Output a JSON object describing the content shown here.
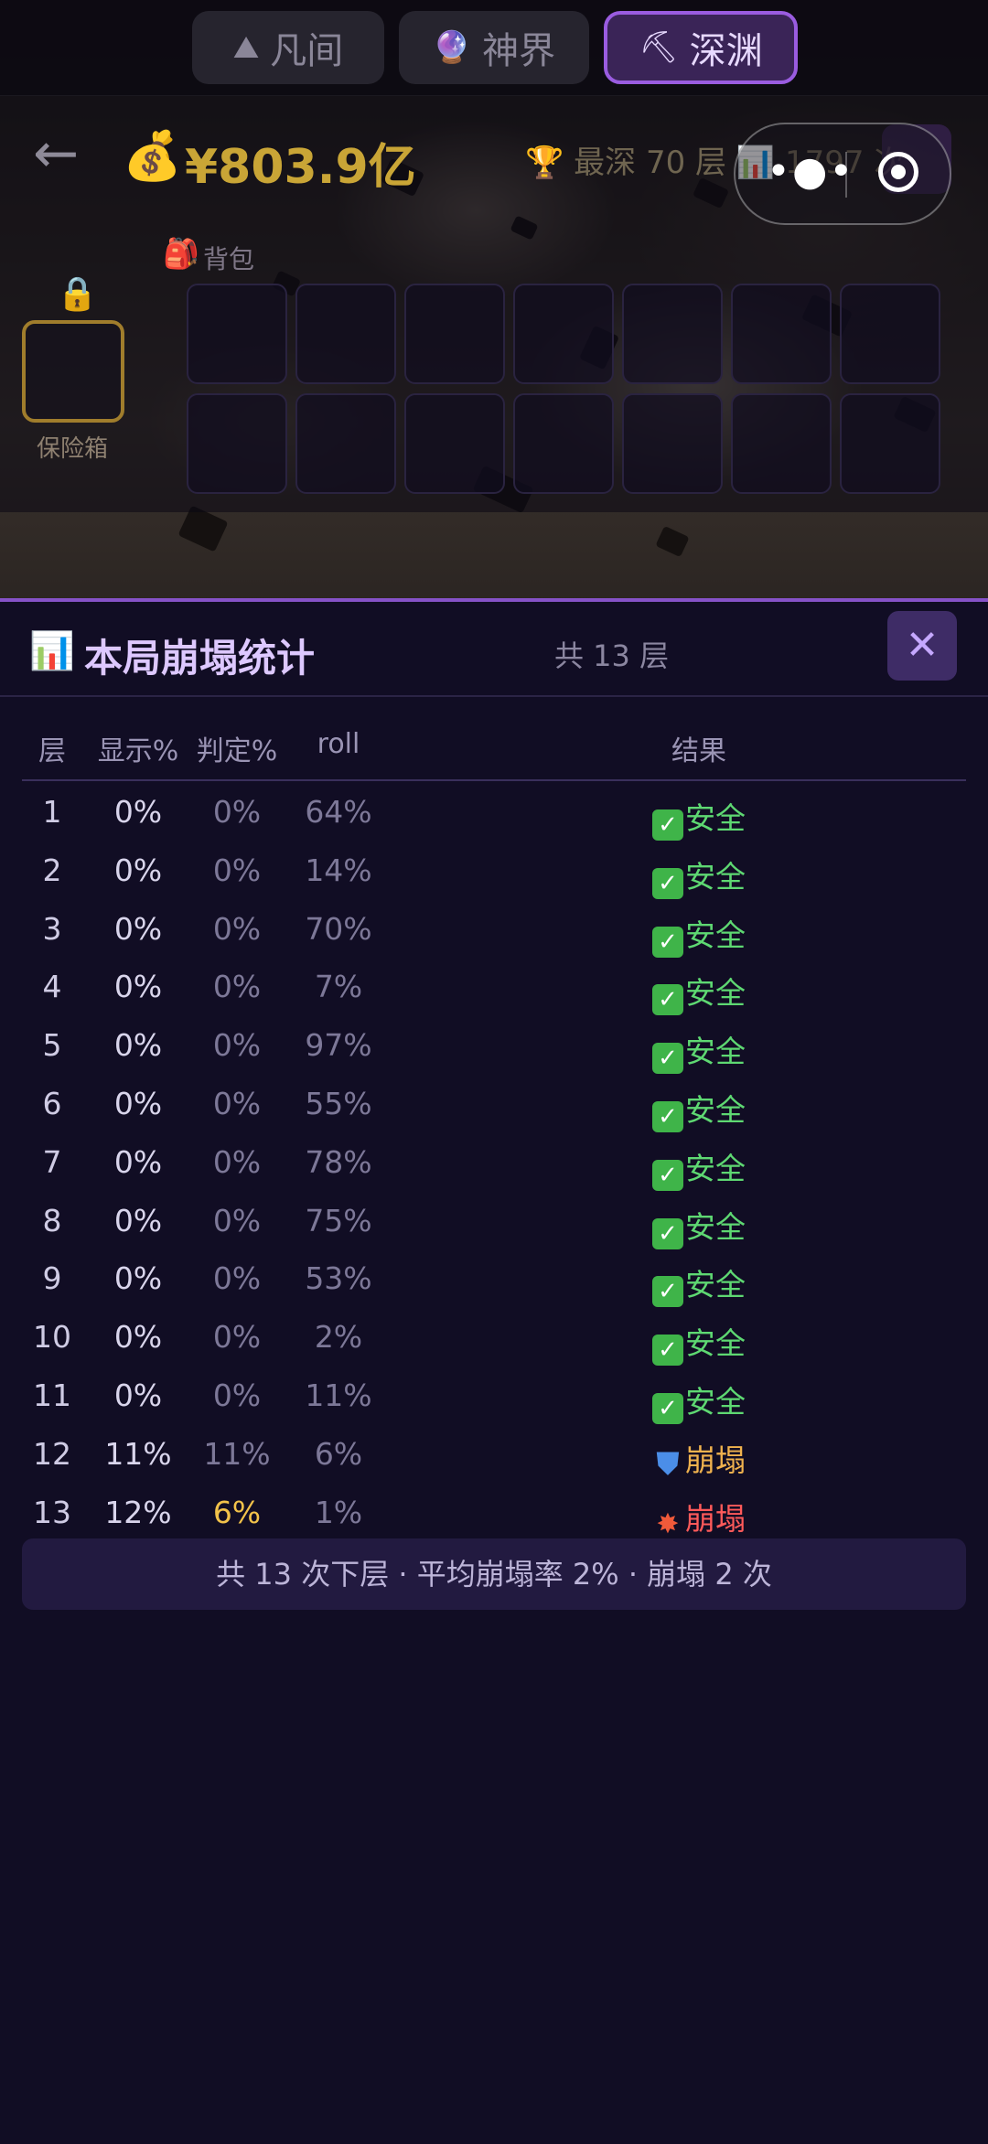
{
  "tabs": [
    {
      "icon": "mountain-icon",
      "glyph": "⛰",
      "label": "凡间",
      "active": false
    },
    {
      "icon": "crystal-ball-icon",
      "glyph": "🔮",
      "label": "神界",
      "active": false
    },
    {
      "icon": "pickaxe-icon",
      "glyph": "⛏",
      "label": "深渊",
      "active": true
    }
  ],
  "header": {
    "back_glyph": "←",
    "money_glyph": "💰",
    "money": "¥803.9亿",
    "trophy_glyph": "🏆",
    "deepest": "最深 70 层",
    "count_glyph": "📊",
    "count": "1797 次"
  },
  "inventory": {
    "lock_glyph": "🔒",
    "safe_label": "保险箱",
    "bag_glyph": "🎒",
    "bag_label": "背包",
    "slot_count": 14
  },
  "panel": {
    "icon_glyph": "📊",
    "title": "本局崩塌统计",
    "total": "共 13 层",
    "close_glyph": "✕",
    "columns": {
      "layer": "层",
      "display": "显示%",
      "judge": "判定%",
      "roll": "roll",
      "result": "结果"
    },
    "rows": [
      {
        "layer": "1",
        "display": "0%",
        "judge": "0%",
        "roll": "64%",
        "result": "安全",
        "status": "safe"
      },
      {
        "layer": "2",
        "display": "0%",
        "judge": "0%",
        "roll": "14%",
        "result": "安全",
        "status": "safe"
      },
      {
        "layer": "3",
        "display": "0%",
        "judge": "0%",
        "roll": "70%",
        "result": "安全",
        "status": "safe"
      },
      {
        "layer": "4",
        "display": "0%",
        "judge": "0%",
        "roll": "7%",
        "result": "安全",
        "status": "safe"
      },
      {
        "layer": "5",
        "display": "0%",
        "judge": "0%",
        "roll": "97%",
        "result": "安全",
        "status": "safe"
      },
      {
        "layer": "6",
        "display": "0%",
        "judge": "0%",
        "roll": "55%",
        "result": "安全",
        "status": "safe"
      },
      {
        "layer": "7",
        "display": "0%",
        "judge": "0%",
        "roll": "78%",
        "result": "安全",
        "status": "safe"
      },
      {
        "layer": "8",
        "display": "0%",
        "judge": "0%",
        "roll": "75%",
        "result": "安全",
        "status": "safe"
      },
      {
        "layer": "9",
        "display": "0%",
        "judge": "0%",
        "roll": "53%",
        "result": "安全",
        "status": "safe"
      },
      {
        "layer": "10",
        "display": "0%",
        "judge": "0%",
        "roll": "2%",
        "result": "安全",
        "status": "safe"
      },
      {
        "layer": "11",
        "display": "0%",
        "judge": "0%",
        "roll": "11%",
        "result": "安全",
        "status": "safe"
      },
      {
        "layer": "12",
        "display": "11%",
        "judge": "11%",
        "roll": "6%",
        "result": "崩塌",
        "status": "shield"
      },
      {
        "layer": "13",
        "display": "12%",
        "judge": "6%",
        "roll": "1%",
        "result": "崩塌",
        "status": "crash"
      }
    ],
    "summary": "共 13 次下层 · 平均崩塌率 2% · 崩塌 2 次"
  }
}
